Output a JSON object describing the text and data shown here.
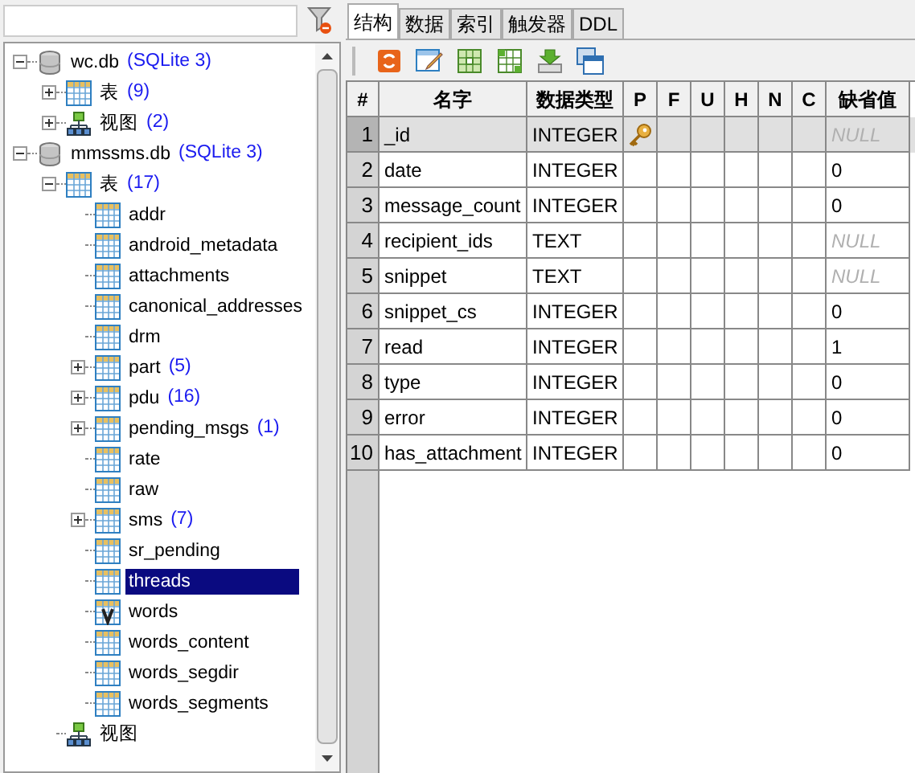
{
  "tree": [
    {
      "label": "wc.db",
      "note": "(SQLite 3)",
      "kind": "database",
      "expanded": true,
      "selected": false,
      "children": [
        {
          "label": "表",
          "note": "(9)",
          "kind": "tables",
          "expanded": false,
          "selected": false
        },
        {
          "label": "视图",
          "note": "(2)",
          "kind": "views",
          "expanded": false,
          "selected": false
        }
      ]
    },
    {
      "label": "mmssms.db",
      "note": "(SQLite 3)",
      "kind": "database",
      "expanded": true,
      "selected": false,
      "children": [
        {
          "label": "表",
          "note": "(17)",
          "kind": "tables",
          "expanded": true,
          "selected": false,
          "children": [
            {
              "label": "addr",
              "kind": "table",
              "selected": false
            },
            {
              "label": "android_metadata",
              "kind": "table",
              "selected": false
            },
            {
              "label": "attachments",
              "kind": "table",
              "selected": false
            },
            {
              "label": "canonical_addresses",
              "kind": "table",
              "selected": false
            },
            {
              "label": "drm",
              "kind": "table",
              "selected": false
            },
            {
              "label": "part",
              "note": "(5)",
              "kind": "table",
              "expanded": false,
              "selected": false
            },
            {
              "label": "pdu",
              "note": "(16)",
              "kind": "table",
              "expanded": false,
              "selected": false
            },
            {
              "label": "pending_msgs",
              "note": "(1)",
              "kind": "table",
              "expanded": false,
              "selected": false
            },
            {
              "label": "rate",
              "kind": "table",
              "selected": false
            },
            {
              "label": "raw",
              "kind": "table",
              "selected": false
            },
            {
              "label": "sms",
              "note": "(7)",
              "kind": "table",
              "expanded": false,
              "selected": false
            },
            {
              "label": "sr_pending",
              "kind": "table",
              "selected": false
            },
            {
              "label": "threads",
              "kind": "table",
              "selected": true
            },
            {
              "label": "words",
              "kind": "virtual",
              "selected": false
            },
            {
              "label": "words_content",
              "kind": "table",
              "selected": false
            },
            {
              "label": "words_segdir",
              "kind": "table",
              "selected": false
            },
            {
              "label": "words_segments",
              "kind": "table",
              "selected": false
            }
          ]
        },
        {
          "label": "视图",
          "kind": "views",
          "selected": false
        }
      ]
    }
  ],
  "tabs": [
    {
      "label": "结构",
      "selected": true
    },
    {
      "label": "数据",
      "selected": false
    },
    {
      "label": "索引",
      "selected": false
    },
    {
      "label": "触发器",
      "selected": false
    },
    {
      "label": "DDL",
      "selected": false
    }
  ],
  "grid": {
    "columns": [
      "#",
      "名字",
      "数据类型",
      "P",
      "F",
      "U",
      "H",
      "N",
      "C",
      "缺省值"
    ],
    "rows": [
      {
        "index": "1",
        "name": "_id",
        "type": "INTEGER",
        "primary_key": true,
        "default": "NULL",
        "is_null": true,
        "selected": true
      },
      {
        "index": "2",
        "name": "date",
        "type": "INTEGER",
        "primary_key": false,
        "default": "0",
        "is_null": false,
        "selected": false
      },
      {
        "index": "3",
        "name": "message_count",
        "type": "INTEGER",
        "primary_key": false,
        "default": "0",
        "is_null": false,
        "selected": false
      },
      {
        "index": "4",
        "name": "recipient_ids",
        "type": "TEXT",
        "primary_key": false,
        "default": "NULL",
        "is_null": true,
        "selected": false
      },
      {
        "index": "5",
        "name": "snippet",
        "type": "TEXT",
        "primary_key": false,
        "default": "NULL",
        "is_null": true,
        "selected": false
      },
      {
        "index": "6",
        "name": "snippet_cs",
        "type": "INTEGER",
        "primary_key": false,
        "default": "0",
        "is_null": false,
        "selected": false
      },
      {
        "index": "7",
        "name": "read",
        "type": "INTEGER",
        "primary_key": false,
        "default": "1",
        "is_null": false,
        "selected": false
      },
      {
        "index": "8",
        "name": "type",
        "type": "INTEGER",
        "primary_key": false,
        "default": "0",
        "is_null": false,
        "selected": false
      },
      {
        "index": "9",
        "name": "error",
        "type": "INTEGER",
        "primary_key": false,
        "default": "0",
        "is_null": false,
        "selected": false
      },
      {
        "index": "10",
        "name": "has_attachment",
        "type": "INTEGER",
        "primary_key": false,
        "default": "0",
        "is_null": false,
        "selected": false
      }
    ]
  }
}
